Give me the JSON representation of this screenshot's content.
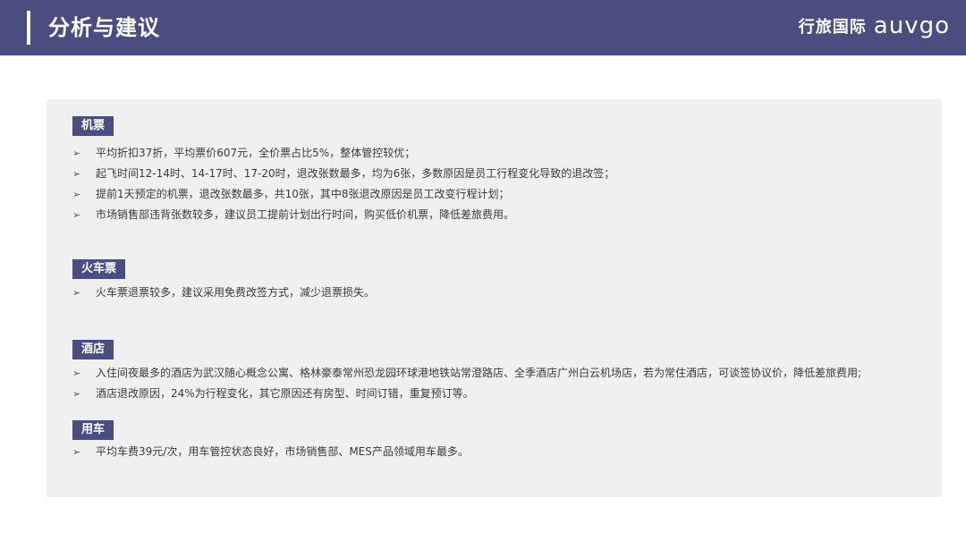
{
  "header": {
    "title": "分析与建议",
    "brand_cn": "行旅国际",
    "brand_en": "auvgo"
  },
  "sections": [
    {
      "tag": "机票",
      "items": [
        "平均折扣37折，平均票价607元，全价票占比5%，整体管控较优；",
        "起飞时间12-14时、14-17时、17-20时，退改张数最多，均为6张，多数原因是员工行程变化导致的退改签；",
        "提前1天预定的机票，退改张数最多，共10张，其中8张退改原因是员工改变行程计划；",
        "市场销售部违背张数较多，建议员工提前计划出行时间，购买低价机票，降低差旅费用。"
      ]
    },
    {
      "tag": "火车票",
      "items": [
        "火车票退票较多，建议采用免费改签方式，减少退票损失。"
      ]
    },
    {
      "tag": "酒店",
      "items": [
        "入住间夜最多的酒店为武汉随心概念公寓、格林豪泰常州恐龙园环球港地铁站常澄路店、全季酒店广州白云机场店，若为常住酒店，可谈签协议价，降低差旅费用;",
        "酒店退改原因，24%为行程变化，其它原因还有房型、时间订错，重复预订等。"
      ]
    },
    {
      "tag": "用车",
      "items": [
        "平均车费39元/次，用车管控状态良好，市场销售部、MES产品领域用车最多。"
      ]
    }
  ],
  "bullet_icon": "➢",
  "colors": {
    "header_bg": "#4b4c7f",
    "tag_bg": "#4b4c7f",
    "panel_bg": "#f0f0f0"
  }
}
